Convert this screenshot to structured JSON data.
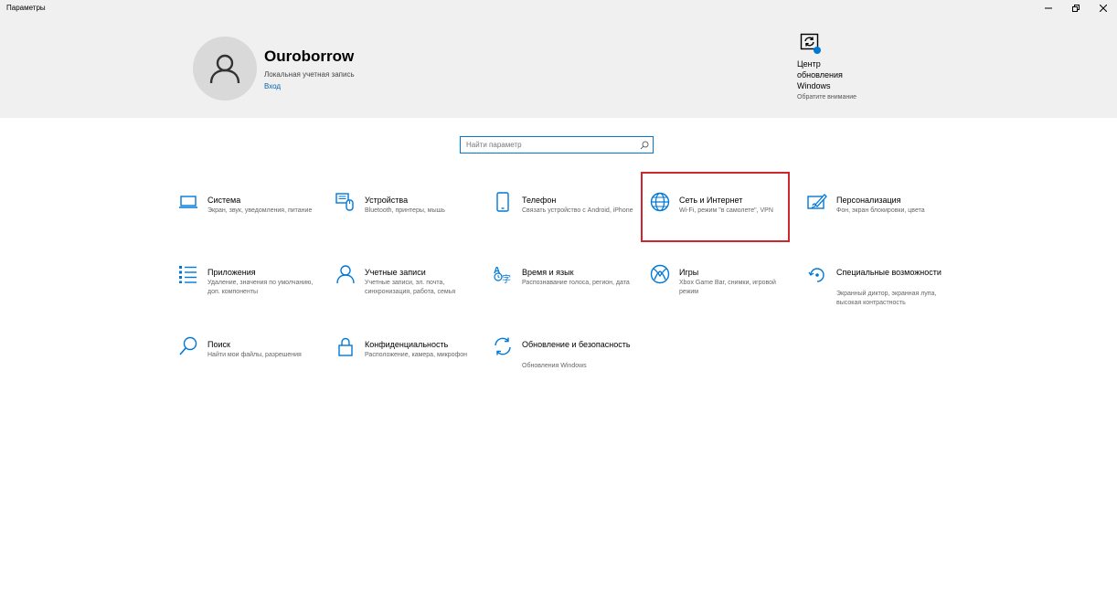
{
  "window": {
    "title": "Параметры"
  },
  "colors": {
    "accent": "#0078d7",
    "link": "#0063b1",
    "highlight": "#d0242e",
    "header_bg": "#f0f0f0"
  },
  "user": {
    "name": "Ouroborrow",
    "account_type": "Локальная учетная запись",
    "login_link": "Вход"
  },
  "update": {
    "icon": "windows-update-icon",
    "title": "Центр обновления Windows",
    "subtitle": "Обратите внимание"
  },
  "search": {
    "placeholder": "Найти параметр",
    "icon": "search-icon"
  },
  "categories": [
    {
      "name": "Система",
      "desc": "Экран, звук, уведомления, питание",
      "icon": "laptop-icon"
    },
    {
      "name": "Устройства",
      "desc": "Bluetooth, принтеры, мышь",
      "icon": "devices-icon"
    },
    {
      "name": "Телефон",
      "desc": "Связать устройство с Android, iPhone",
      "icon": "phone-icon"
    },
    {
      "name": "Сеть и Интернет",
      "desc": "Wi-Fi, режим \"в самолете\", VPN",
      "icon": "globe-icon"
    },
    {
      "name": "Персонализация",
      "desc": "Фон, экран блокировки, цвета",
      "icon": "personalization-icon"
    },
    {
      "name": "Приложения",
      "desc": "Удаление, значения по умолчанию, доп. компоненты",
      "icon": "apps-icon"
    },
    {
      "name": "Учетные записи",
      "desc": "Учетные записи, эл. почта, синхронизация, работа, семья",
      "icon": "person-icon"
    },
    {
      "name": "Время и язык",
      "desc": "Распознавание голоса, регион, дата",
      "icon": "time-language-icon"
    },
    {
      "name": "Игры",
      "desc": "Xbox Game Bar, снимки, игровой режим",
      "icon": "xbox-icon"
    },
    {
      "name": "Специальные возможности",
      "desc": "Экранный диктор, экранная лупа, высокая контрастность",
      "icon": "accessibility-icon"
    },
    {
      "name": "Поиск",
      "desc": "Найти мои файлы, разрешения",
      "icon": "search-category-icon"
    },
    {
      "name": "Конфиденциальность",
      "desc": "Расположение, камера, микрофон",
      "icon": "lock-icon"
    },
    {
      "name": "Обновление и безопасность",
      "desc": "Обновления Windows",
      "icon": "sync-icon"
    }
  ]
}
